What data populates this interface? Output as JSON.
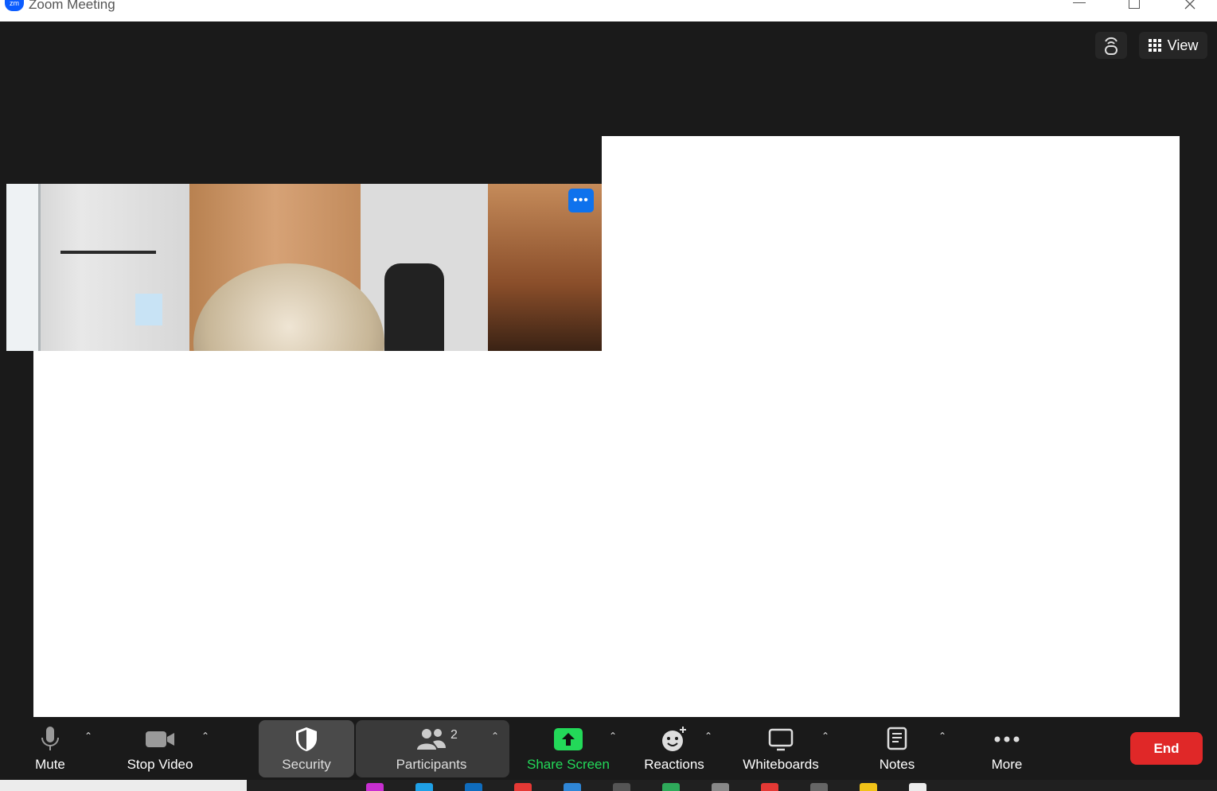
{
  "window": {
    "title": "Zoom Meeting",
    "logo_text": "zm"
  },
  "top_controls": {
    "view_label": "View"
  },
  "video_tile": {
    "menu_label": "•••"
  },
  "toolbar": {
    "mute": "Mute",
    "stop_video": "Stop Video",
    "security": "Security",
    "participants": "Participants",
    "participant_count": "2",
    "share_screen": "Share Screen",
    "reactions": "Reactions",
    "whiteboards": "Whiteboards",
    "notes": "Notes",
    "more": "More",
    "end": "End"
  },
  "colors": {
    "background": "#1a1a1a",
    "share_green": "#23d959",
    "end_red": "#e02828",
    "accent_blue": "#0e72ed"
  }
}
